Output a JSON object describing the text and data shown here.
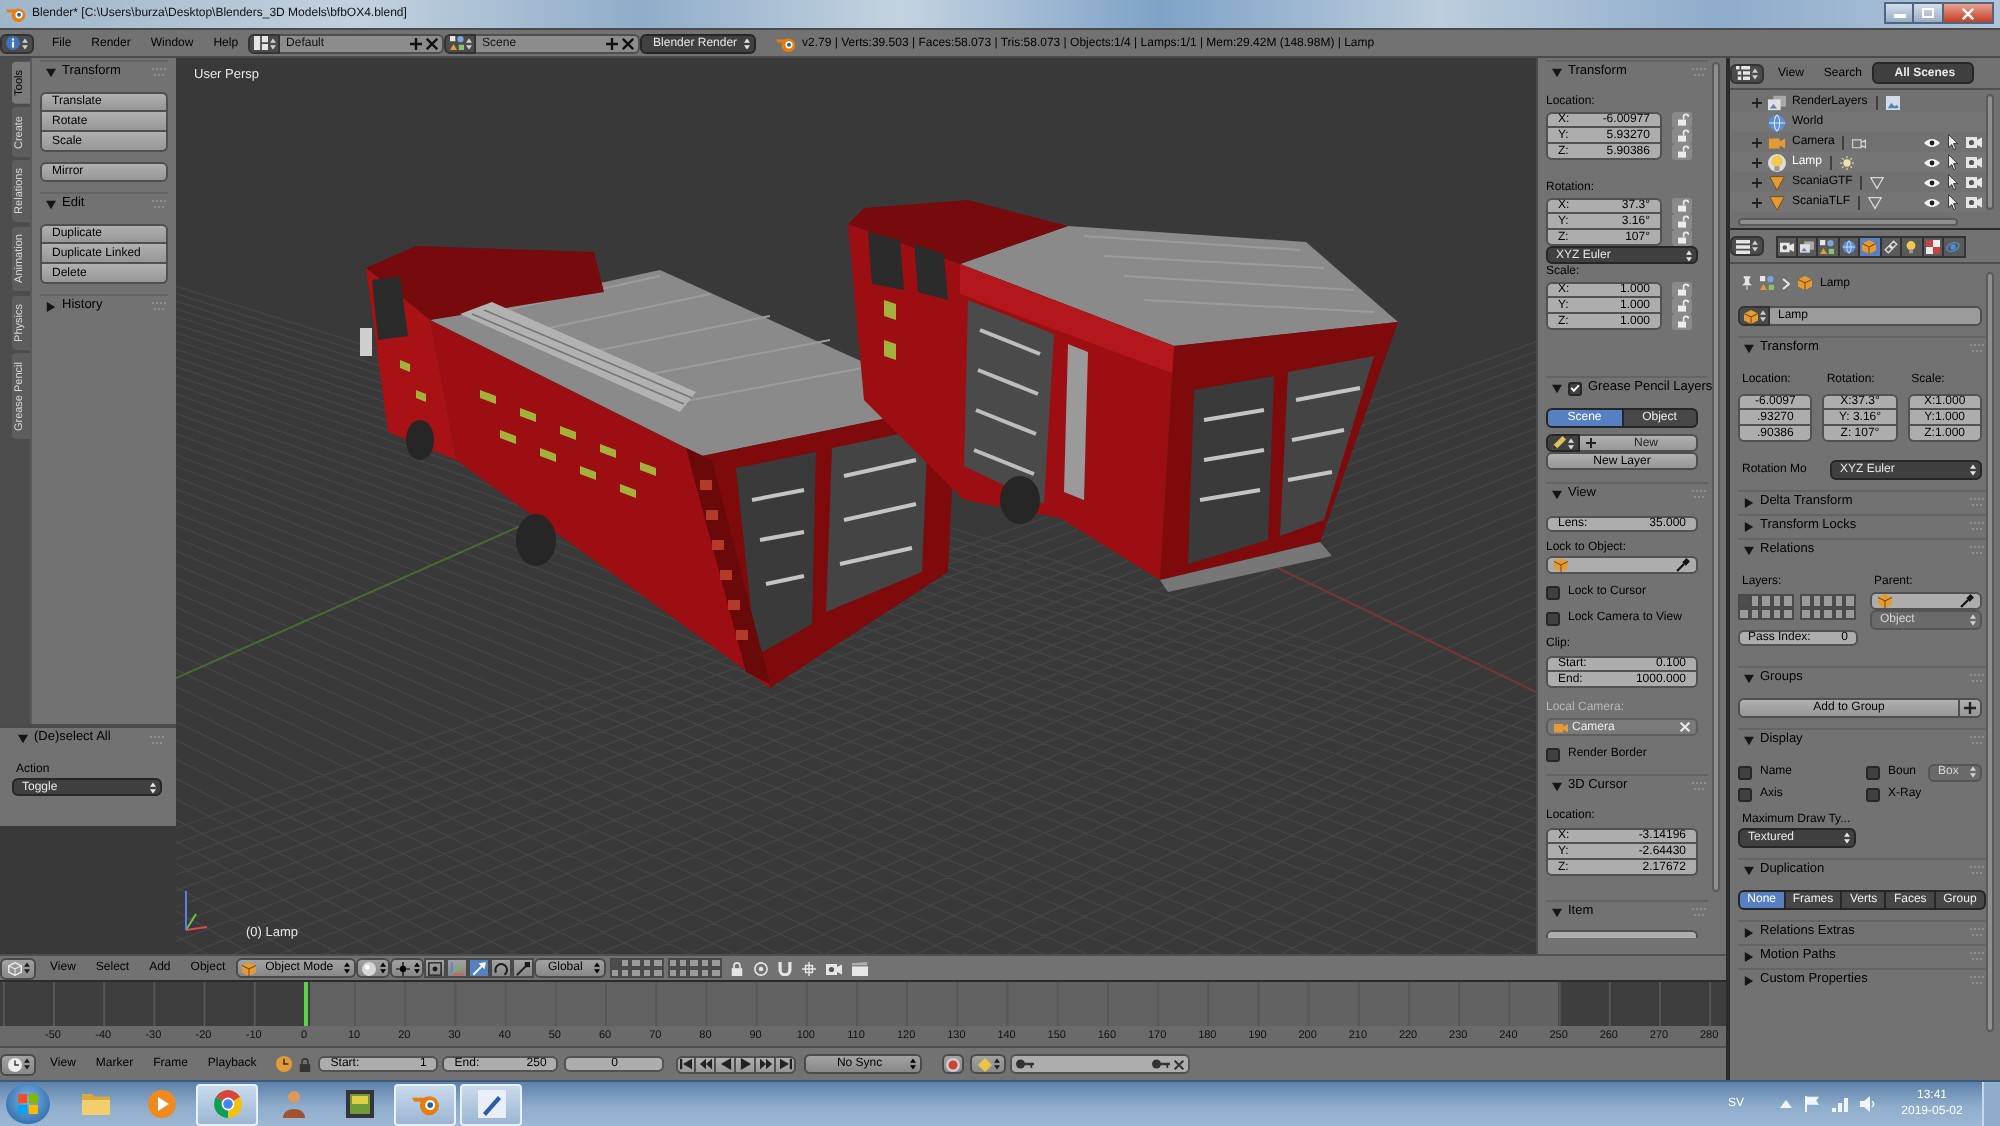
{
  "window": {
    "title": "Blender* [C:\\Users\\burza\\Desktop\\Blenders_3D Models\\bfbOX4.blend]"
  },
  "info_header": {
    "menus": [
      "File",
      "Render",
      "Window",
      "Help"
    ],
    "screen_layout": "Default",
    "scene": "Scene",
    "render_engine": "Blender Render",
    "stats": "v2.79 | Verts:39.503 | Faces:58.073 | Tris:58.073 | Objects:1/4 | Lamps:1/1 | Mem:29.42M (148.98M) | Lamp"
  },
  "tool_tabs": [
    {
      "label": "Tools",
      "selected": true
    },
    {
      "label": "Create",
      "selected": false
    },
    {
      "label": "Relations",
      "selected": false
    },
    {
      "label": "Animation",
      "selected": false
    },
    {
      "label": "Physics",
      "selected": false
    },
    {
      "label": "Grease Pencil",
      "selected": false
    }
  ],
  "tool_shelf": [
    {
      "title": "Transform",
      "expanded": true,
      "groups": [
        [
          "Translate",
          "Rotate",
          "Scale"
        ],
        [
          "Mirror"
        ]
      ]
    },
    {
      "title": "Edit",
      "expanded": true,
      "groups": [
        [
          "Duplicate",
          "Duplicate Linked",
          "Delete"
        ]
      ]
    },
    {
      "title": "History",
      "expanded": false
    }
  ],
  "last_operator": {
    "title": "(De)select All",
    "expanded": true,
    "label": "Action",
    "value": "Toggle"
  },
  "viewport": {
    "view_name": "User Persp",
    "object_label": "(0) Lamp"
  },
  "n_panel": {
    "transform": {
      "title": "Transform",
      "expanded": true,
      "groups": [
        {
          "label": "Location:",
          "fields": [
            {
              "axis": "X:",
              "value": "-6.00977",
              "locked": false
            },
            {
              "axis": "Y:",
              "value": "5.93270",
              "locked": false
            },
            {
              "axis": "Z:",
              "value": "5.90386",
              "locked": false
            }
          ]
        },
        {
          "label": "Rotation:",
          "fields": [
            {
              "axis": "X:",
              "value": "37.3°",
              "locked": false
            },
            {
              "axis": "Y:",
              "value": "3.16°",
              "locked": false
            },
            {
              "axis": "Z:",
              "value": "107°",
              "locked": false
            }
          ],
          "mode": "XYZ Euler"
        },
        {
          "label": "Scale:",
          "fields": [
            {
              "axis": "X:",
              "value": "1.000",
              "locked": false
            },
            {
              "axis": "Y:",
              "value": "1.000",
              "locked": false
            },
            {
              "axis": "Z:",
              "value": "1.000",
              "locked": false
            }
          ]
        }
      ]
    },
    "grease_pencil": {
      "title": "Grease Pencil Layers",
      "expanded": true,
      "checked": true,
      "tabs": [
        {
          "label": "Scene",
          "selected": true
        },
        {
          "label": "Object",
          "selected": false
        }
      ],
      "new": "New",
      "new_layer": "New Layer"
    },
    "view": {
      "title": "View",
      "expanded": true,
      "lens_label": "Lens:",
      "lens": "35.000",
      "lock_label": "Lock to Object:",
      "checks": [
        {
          "label": "Lock to Cursor",
          "checked": false
        },
        {
          "label": "Lock Camera to View",
          "checked": false
        }
      ],
      "clip_label": "Clip:",
      "clip": [
        {
          "label": "Start:",
          "value": "0.100"
        },
        {
          "label": "End:",
          "value": "1000.000"
        }
      ],
      "camera_label": "Local Camera:",
      "camera": "Camera",
      "camera_disabled": true,
      "border": {
        "label": "Render Border",
        "checked": false
      }
    },
    "cursor": {
      "title": "3D Cursor",
      "expanded": true,
      "label": "Location:",
      "fields": [
        {
          "axis": "X:",
          "value": "-3.14196"
        },
        {
          "axis": "Y:",
          "value": "-2.64430"
        },
        {
          "axis": "Z:",
          "value": "2.17672"
        }
      ]
    },
    "item": {
      "title": "Item",
      "expanded": true
    }
  },
  "outliner": {
    "menus": [
      "View",
      "Search"
    ],
    "filter": "All Scenes",
    "items": [
      {
        "name": "RenderLayers",
        "kind": "render_layers",
        "selected": false,
        "expanded": false
      },
      {
        "name": "World",
        "kind": "world",
        "selected": false
      },
      {
        "name": "Camera",
        "kind": "camera",
        "selected": false,
        "expanded": false
      },
      {
        "name": "Lamp",
        "kind": "lamp",
        "selected": true,
        "expanded": false
      },
      {
        "name": "ScaniaGTF",
        "kind": "mesh",
        "selected": false,
        "expanded": false
      },
      {
        "name": "ScaniaTLF",
        "kind": "mesh",
        "selected": false,
        "expanded": false
      }
    ]
  },
  "properties": {
    "tabs": [
      {
        "kind": "render",
        "selected": false
      },
      {
        "kind": "render_layers",
        "selected": false
      },
      {
        "kind": "scene",
        "selected": false
      },
      {
        "kind": "world",
        "selected": false
      },
      {
        "kind": "object",
        "selected": true
      },
      {
        "kind": "constraints",
        "selected": false
      },
      {
        "kind": "data",
        "selected": false
      },
      {
        "kind": "texture",
        "selected": false
      },
      {
        "kind": "physics",
        "selected": false
      }
    ],
    "context": "Lamp",
    "name": "Lamp",
    "panels": [
      {
        "kind": "transform",
        "title": "Transform",
        "expanded": true,
        "columns": [
          {
            "label": "Location:",
            "values": [
              "-6.0097",
              ".93270",
              ".90386"
            ]
          },
          {
            "label": "Rotation:",
            "values": [
              "X:37.3°",
              "Y: 3.16°",
              "Z: 107°"
            ]
          },
          {
            "label": "Scale:",
            "values": [
              "X:1.000",
              "Y:1.000",
              "Z:1.000"
            ]
          }
        ],
        "mode_label": "Rotation Mo",
        "mode": "XYZ Euler"
      },
      {
        "kind": "plain",
        "title": "Delta Transform",
        "expanded": false
      },
      {
        "kind": "plain",
        "title": "Transform Locks",
        "expanded": false
      },
      {
        "kind": "relations",
        "title": "Relations",
        "expanded": true,
        "layers_label": "Layers:",
        "layers": [
          {
            "selected": true
          },
          {
            "selected": false
          },
          {
            "selected": false
          },
          {
            "selected": false
          },
          {
            "selected": false
          },
          {
            "selected": false
          },
          {
            "selected": false
          },
          {
            "selected": false
          },
          {
            "selected": false
          },
          {
            "selected": false
          },
          {
            "selected": false
          },
          {
            "selected": false
          },
          {
            "selected": false
          },
          {
            "selected": false
          },
          {
            "selected": false
          },
          {
            "selected": false
          },
          {
            "selected": false
          },
          {
            "selected": false
          },
          {
            "selected": false
          },
          {
            "selected": false
          }
        ],
        "parent_label": "Parent:",
        "parent_type": "Object",
        "parent_type_disabled": true,
        "pass_index_label": "Pass Index:",
        "pass_index": "0"
      },
      {
        "kind": "groups",
        "title": "Groups",
        "expanded": true,
        "button": "Add to Group"
      },
      {
        "kind": "display",
        "title": "Display",
        "expanded": true,
        "checks": [
          {
            "label": "Name",
            "checked": false
          },
          {
            "label": "Boun",
            "checked": false,
            "dropdown": "Box",
            "dropdown_disabled": true
          },
          {
            "label": "Axis",
            "checked": false
          },
          {
            "label": "X-Ray",
            "checked": false
          }
        ],
        "max_draw_label": "Maximum Draw Ty...",
        "max_draw": "Textured"
      },
      {
        "kind": "duplication",
        "title": "Duplication",
        "expanded": true,
        "options": [
          {
            "label": "None",
            "selected": true
          },
          {
            "label": "Frames",
            "selected": false
          },
          {
            "label": "Verts",
            "selected": false
          },
          {
            "label": "Faces",
            "selected": false
          },
          {
            "label": "Group",
            "selected": false
          }
        ]
      },
      {
        "kind": "plain",
        "title": "Relations Extras",
        "expanded": false
      },
      {
        "kind": "plain",
        "title": "Motion Paths",
        "expanded": false
      },
      {
        "kind": "plain",
        "title": "Custom Properties",
        "expanded": false
      }
    ]
  },
  "view3d_header": {
    "menus": [
      "View",
      "Select",
      "Add",
      "Object"
    ],
    "mode": "Object Mode",
    "orientation": "Global",
    "manipulators": [
      {
        "kind": "center",
        "selected": false
      },
      {
        "kind": "axes",
        "selected": false
      },
      {
        "kind": "translate",
        "selected": true
      },
      {
        "kind": "rotate",
        "selected": false
      },
      {
        "kind": "scale",
        "selected": false
      }
    ],
    "layers": [
      {
        "selected": true
      },
      {
        "selected": false
      },
      {
        "selected": false
      },
      {
        "selected": false
      },
      {
        "selected": false
      },
      {
        "selected": false
      },
      {
        "selected": false
      },
      {
        "selected": false
      },
      {
        "selected": false
      },
      {
        "selected": false
      },
      {
        "selected": false
      },
      {
        "selected": false
      },
      {
        "selected": false
      },
      {
        "selected": false
      },
      {
        "selected": false
      },
      {
        "selected": false
      },
      {
        "selected": false
      },
      {
        "selected": false
      },
      {
        "selected": false
      },
      {
        "selected": false
      }
    ]
  },
  "timeline": {
    "ticks": [
      "-50",
      "-40",
      "-30",
      "-20",
      "-10",
      "0",
      "10",
      "20",
      "30",
      "40",
      "50",
      "60",
      "70",
      "80",
      "90",
      "100",
      "110",
      "120",
      "130",
      "140",
      "150",
      "160",
      "170",
      "180",
      "190",
      "200",
      "210",
      "220",
      "230",
      "240",
      "250",
      "260",
      "270",
      "280"
    ],
    "menus": [
      "View",
      "Marker",
      "Frame",
      "Playback"
    ],
    "start_label": "Start:",
    "start": "1",
    "end_label": "End:",
    "end": "250",
    "frame": "0",
    "sync": "No Sync"
  },
  "taskbar": {
    "apps": [
      {
        "kind": "folder",
        "selected": false
      },
      {
        "kind": "media",
        "selected": false
      },
      {
        "kind": "browser",
        "selected": true
      },
      {
        "kind": "figure",
        "selected": false
      },
      {
        "kind": "tile",
        "selected": false
      },
      {
        "kind": "blender",
        "selected": true
      },
      {
        "kind": "pen",
        "selected": true
      }
    ],
    "language": "SV",
    "time": "13:41",
    "date": "2019-05-02"
  }
}
